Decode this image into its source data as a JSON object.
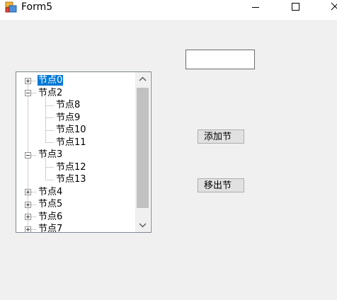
{
  "window": {
    "title": "Form5",
    "icon": "winforms-app-icon",
    "controls": [
      "minimize-icon",
      "maximize-icon",
      "close-icon"
    ]
  },
  "textbox": {
    "value": ""
  },
  "buttons": {
    "add_label": "添加节",
    "remove_label": "移出节"
  },
  "tree": {
    "nodes": [
      {
        "label": "节点0",
        "level": 0,
        "expander": "plus",
        "selected": true
      },
      {
        "label": "节点2",
        "level": 0,
        "expander": "minus",
        "selected": false
      },
      {
        "label": "节点8",
        "level": 1,
        "expander": "none",
        "selected": false
      },
      {
        "label": "节点9",
        "level": 1,
        "expander": "none",
        "selected": false
      },
      {
        "label": "节点10",
        "level": 1,
        "expander": "none",
        "selected": false
      },
      {
        "label": "节点11",
        "level": 1,
        "expander": "none",
        "selected": false
      },
      {
        "label": "节点3",
        "level": 0,
        "expander": "minus",
        "selected": false
      },
      {
        "label": "节点12",
        "level": 1,
        "expander": "none",
        "selected": false
      },
      {
        "label": "节点13",
        "level": 1,
        "expander": "none",
        "selected": false
      },
      {
        "label": "节点4",
        "level": 0,
        "expander": "plus",
        "selected": false
      },
      {
        "label": "节点5",
        "level": 0,
        "expander": "plus",
        "selected": false
      },
      {
        "label": "节点6",
        "level": 0,
        "expander": "plus",
        "selected": false
      },
      {
        "label": "节点7",
        "level": 0,
        "expander": "plus",
        "selected": false
      }
    ]
  },
  "colors": {
    "selection": "#0078d7",
    "window_bg": "#f0f0f0",
    "scroll_thumb": "#c1c1c1"
  }
}
